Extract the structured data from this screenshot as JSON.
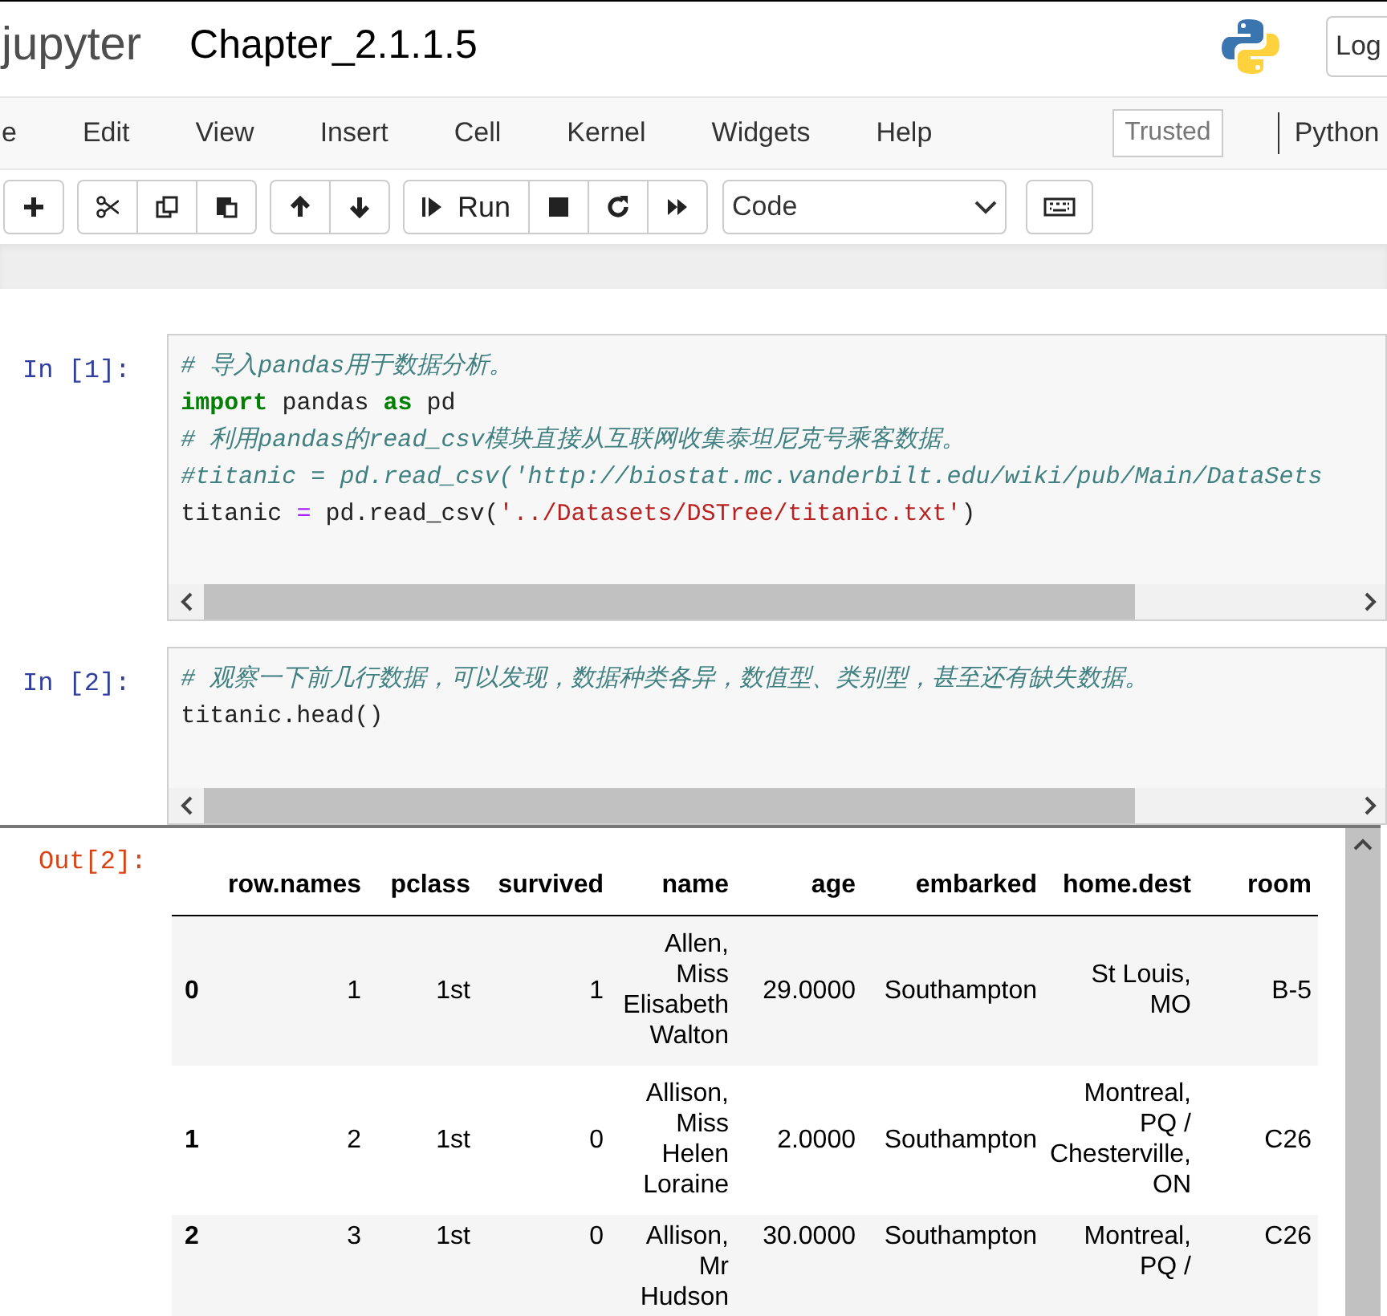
{
  "header": {
    "logo": "jupyter",
    "notebook_title": "Chapter_2.1.1.5",
    "login_button": "Log"
  },
  "menu": {
    "items": [
      "e",
      "Edit",
      "View",
      "Insert",
      "Cell",
      "Kernel",
      "Widgets",
      "Help"
    ],
    "trusted_badge": "Trusted",
    "kernel_name": "Python"
  },
  "toolbar": {
    "groups": [
      [
        {
          "kind": "plus"
        }
      ],
      [
        {
          "kind": "cut"
        },
        {
          "kind": "copy"
        },
        {
          "kind": "paste"
        }
      ],
      [
        {
          "kind": "up"
        },
        {
          "kind": "down"
        }
      ],
      [
        {
          "kind": "run",
          "label": "Run"
        },
        {
          "kind": "stop"
        },
        {
          "kind": "restart"
        },
        {
          "kind": "fast-forward"
        }
      ]
    ],
    "cell_type": "Code"
  },
  "cells": [
    {
      "prompt": "In [1]:",
      "lines": [
        [
          {
            "kind": "comment",
            "text": "# 导入pandas用于数据分析。"
          }
        ],
        [
          {
            "kind": "keyword",
            "text": "import"
          },
          {
            "kind": "plain",
            "text": " pandas "
          },
          {
            "kind": "keyword",
            "text": "as"
          },
          {
            "kind": "plain",
            "text": " pd"
          }
        ],
        [
          {
            "kind": "comment",
            "text": "# 利用pandas的read_csv模块直接从互联网收集泰坦尼克号乘客数据。"
          }
        ],
        [
          {
            "kind": "comment",
            "text": "#titanic = pd.read_csv('http://biostat.mc.vanderbilt.edu/wiki/pub/Main/DataSets"
          }
        ],
        [
          {
            "kind": "plain",
            "text": "titanic "
          },
          {
            "kind": "operator",
            "text": "="
          },
          {
            "kind": "plain",
            "text": " pd.read_csv("
          },
          {
            "kind": "string",
            "text": "'../Datasets/DSTree/titanic.txt'"
          },
          {
            "kind": "plain",
            "text": ")"
          }
        ]
      ]
    },
    {
      "prompt": "In [2]:",
      "lines": [
        [
          {
            "kind": "comment",
            "text": "# 观察一下前几行数据，可以发现，数据种类各异，数值型、类别型，甚至还有缺失数据。"
          }
        ],
        [
          {
            "kind": "plain",
            "text": "titanic.head()"
          }
        ]
      ],
      "output": {
        "prompt": "Out[2]:",
        "table": {
          "columns": [
            "",
            "row.names",
            "pclass",
            "survived",
            "name",
            "age",
            "embarked",
            "home.dest",
            "room"
          ],
          "rows": [
            [
              "0",
              "1",
              "1st",
              "1",
              "Allen, Miss Elisabeth Walton",
              "29.0000",
              "Southampton",
              "St Louis, MO",
              "B-5"
            ],
            [
              "1",
              "2",
              "1st",
              "0",
              "Allison, Miss Helen Loraine",
              "2.0000",
              "Southampton",
              "Montreal, PQ / Chesterville, ON",
              "C26"
            ],
            [
              "2",
              "3",
              "1st",
              "0",
              "Allison, Mr Hudson",
              "30.0000",
              "Southampton",
              "Montreal, PQ /",
              "C26"
            ]
          ]
        }
      }
    }
  ]
}
